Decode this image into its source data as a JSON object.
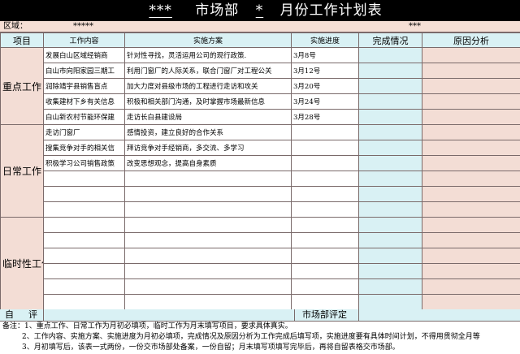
{
  "header": {
    "title_stars": "***",
    "title_dept": "市场部",
    "title_star_mid": "*",
    "title_rest": "月份工作计划表"
  },
  "region": {
    "label": "区域：",
    "value_left": "*****",
    "value_right": "***"
  },
  "columns": [
    "项目",
    "工作内容",
    "实施方案",
    "实施进度",
    "完成情况",
    "原因分析"
  ],
  "sections": [
    {
      "category": "重点工作",
      "rows": [
        {
          "content": "发展白山区域经销商",
          "plan": "针对性寻找，灵活运用公司的现行政策.",
          "progress": "3月8号"
        },
        {
          "content": "白山市向阳家园三期工",
          "plan": "利用门窗厂的人际关系，联合门窗厂对工程公关",
          "progress": "3月12号"
        },
        {
          "content": "润除靖宇县销售盲点",
          "plan": "加大力度对县级市场的工程进行走访和攻关",
          "progress": "3月20号"
        },
        {
          "content": "收集建材下乡有关信息",
          "plan": "积极和相关部门沟通，及时掌握市场最新信息",
          "progress": "3月24号"
        },
        {
          "content": "白山新农村节能环保建",
          "plan": "走访长白县建设局",
          "progress": "3月28号"
        }
      ]
    },
    {
      "category": "日常工作",
      "rows": [
        {
          "content": "走访门窗厂",
          "plan": "感情投资，建立良好的合作关系",
          "progress": ""
        },
        {
          "content": "搜集竞争对手的相关信",
          "plan": "拜访竞争对手经销商，多交流、多学习",
          "progress": ""
        },
        {
          "content": "积极学习公司销售政策",
          "plan": "改变思想观念，提高自身素质",
          "progress": ""
        },
        {
          "content": "",
          "plan": "",
          "progress": ""
        },
        {
          "content": "",
          "plan": "",
          "progress": ""
        },
        {
          "content": "",
          "plan": "",
          "progress": ""
        }
      ]
    },
    {
      "category": "临时性工作",
      "rows": [
        {
          "content": "",
          "plan": "",
          "progress": ""
        },
        {
          "content": "",
          "plan": "",
          "progress": ""
        },
        {
          "content": "",
          "plan": "",
          "progress": ""
        },
        {
          "content": "",
          "plan": "",
          "progress": ""
        },
        {
          "content": "",
          "plan": "",
          "progress": ""
        },
        {
          "content": "",
          "plan": "",
          "progress": ""
        }
      ]
    }
  ],
  "footer": {
    "self_eval": "自评",
    "dept_eval": "市场部评定"
  },
  "notes": [
    "备注：1、重点工作、日常工作为月初必填项，临时工作为月末填写项目，要求具体真实。",
    "2、工作内容、实施方案、实施进度为月初必填项，完成情况及原因分析为工作完成后填写项，实施进度要有具体时间计划，不得用贯彻全月等",
    "3、月初填写后，该表一式两份，一份交市场部处备案，一份自留；月末填写项填写完毕后，再将自留表格交市场部。"
  ],
  "colors": {
    "title_bg": "#000000",
    "header_bg": "#d9f1f4",
    "category_bg": "#f3ddd5"
  }
}
